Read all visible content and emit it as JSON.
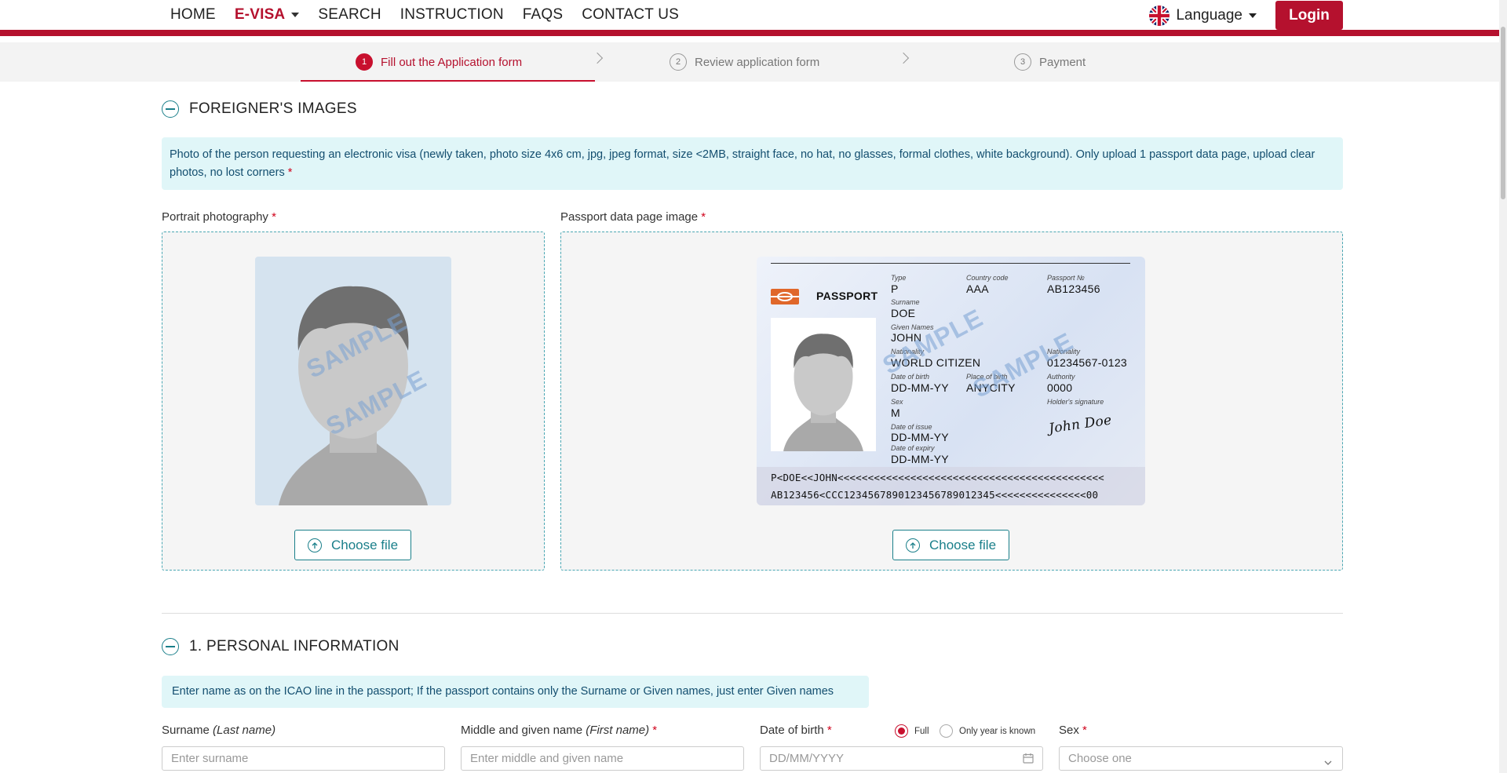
{
  "nav": {
    "items": [
      {
        "label": "HOME",
        "active": false
      },
      {
        "label": "E-VISA",
        "active": true,
        "dropdown": true
      },
      {
        "label": "SEARCH",
        "active": false
      },
      {
        "label": "INSTRUCTION",
        "active": false
      },
      {
        "label": "FAQS",
        "active": false
      },
      {
        "label": "CONTACT US",
        "active": false
      }
    ],
    "language_label": "Language",
    "login_label": "Login"
  },
  "stepper": {
    "steps": [
      {
        "num": "1",
        "label": "Fill out the Application form",
        "active": true
      },
      {
        "num": "2",
        "label": "Review application form",
        "active": false
      },
      {
        "num": "3",
        "label": "Payment",
        "active": false
      }
    ]
  },
  "images_section": {
    "title": "FOREIGNER'S IMAGES",
    "info": "Photo of the person requesting an electronic visa (newly taken, photo size 4x6 cm, jpg, jpeg format, size <2MB, straight face, no hat, no glasses, formal clothes, white background). Only upload 1 passport data page, upload clear photos, no lost corners",
    "portrait_label": "Portrait photography",
    "passport_label": "Passport data page image",
    "choose_file_label": "Choose file",
    "watermark": "SAMPLE"
  },
  "passport_sample": {
    "header": "PASSPORT",
    "type_label": "Type",
    "type": "P",
    "country_label": "Country code",
    "country": "AAA",
    "number_label": "Passport №",
    "number": "AB123456",
    "surname_label": "Surname",
    "surname": "DOE",
    "given_label": "Given Names",
    "given": "JOHN",
    "nationality_label": "Nationality",
    "nationality": "WORLD CITIZEN",
    "personal_no_label": "Nationality",
    "personal_no": "01234567-0123",
    "dob_label": "Date of birth",
    "dob": "DD-MM-YY",
    "pob_label": "Place of birth",
    "pob": "ANYCITY",
    "authority_label": "Authority",
    "authority": "0000",
    "sex_label": "Sex",
    "sex": "M",
    "signature_label": "Holder's signature",
    "signature": "John Doe",
    "issue_label": "Date of issue",
    "issue": "DD-MM-YY",
    "expiry_label": "Date of expiry",
    "expiry": "DD-MM-YY",
    "mrz1": "P<DOE<<JOHN<<<<<<<<<<<<<<<<<<<<<<<<<<<<<<<<<<<<<<<<<<<<",
    "mrz2": "AB123456<CCC1234567890123456789012345<<<<<<<<<<<<<<<00"
  },
  "personal_section": {
    "title": "1. PERSONAL INFORMATION",
    "info": "Enter name as on the ICAO line in the passport; If the passport contains only the Surname or Given names, just enter Given names",
    "surname_label": "Surname",
    "surname_hint": "(Last name)",
    "surname_placeholder": "Enter surname",
    "given_label": "Middle and given name",
    "given_hint": "(First name)",
    "given_placeholder": "Enter middle and given name",
    "dob_label": "Date of birth",
    "dob_placeholder": "DD/MM/YYYY",
    "dob_option_full": "Full",
    "dob_option_year": "Only year is known",
    "sex_label": "Sex",
    "sex_placeholder": "Choose one"
  },
  "colors": {
    "brand": "#b5112e",
    "accent": "#1a7f8a",
    "info_bg": "#e0f6f8"
  }
}
